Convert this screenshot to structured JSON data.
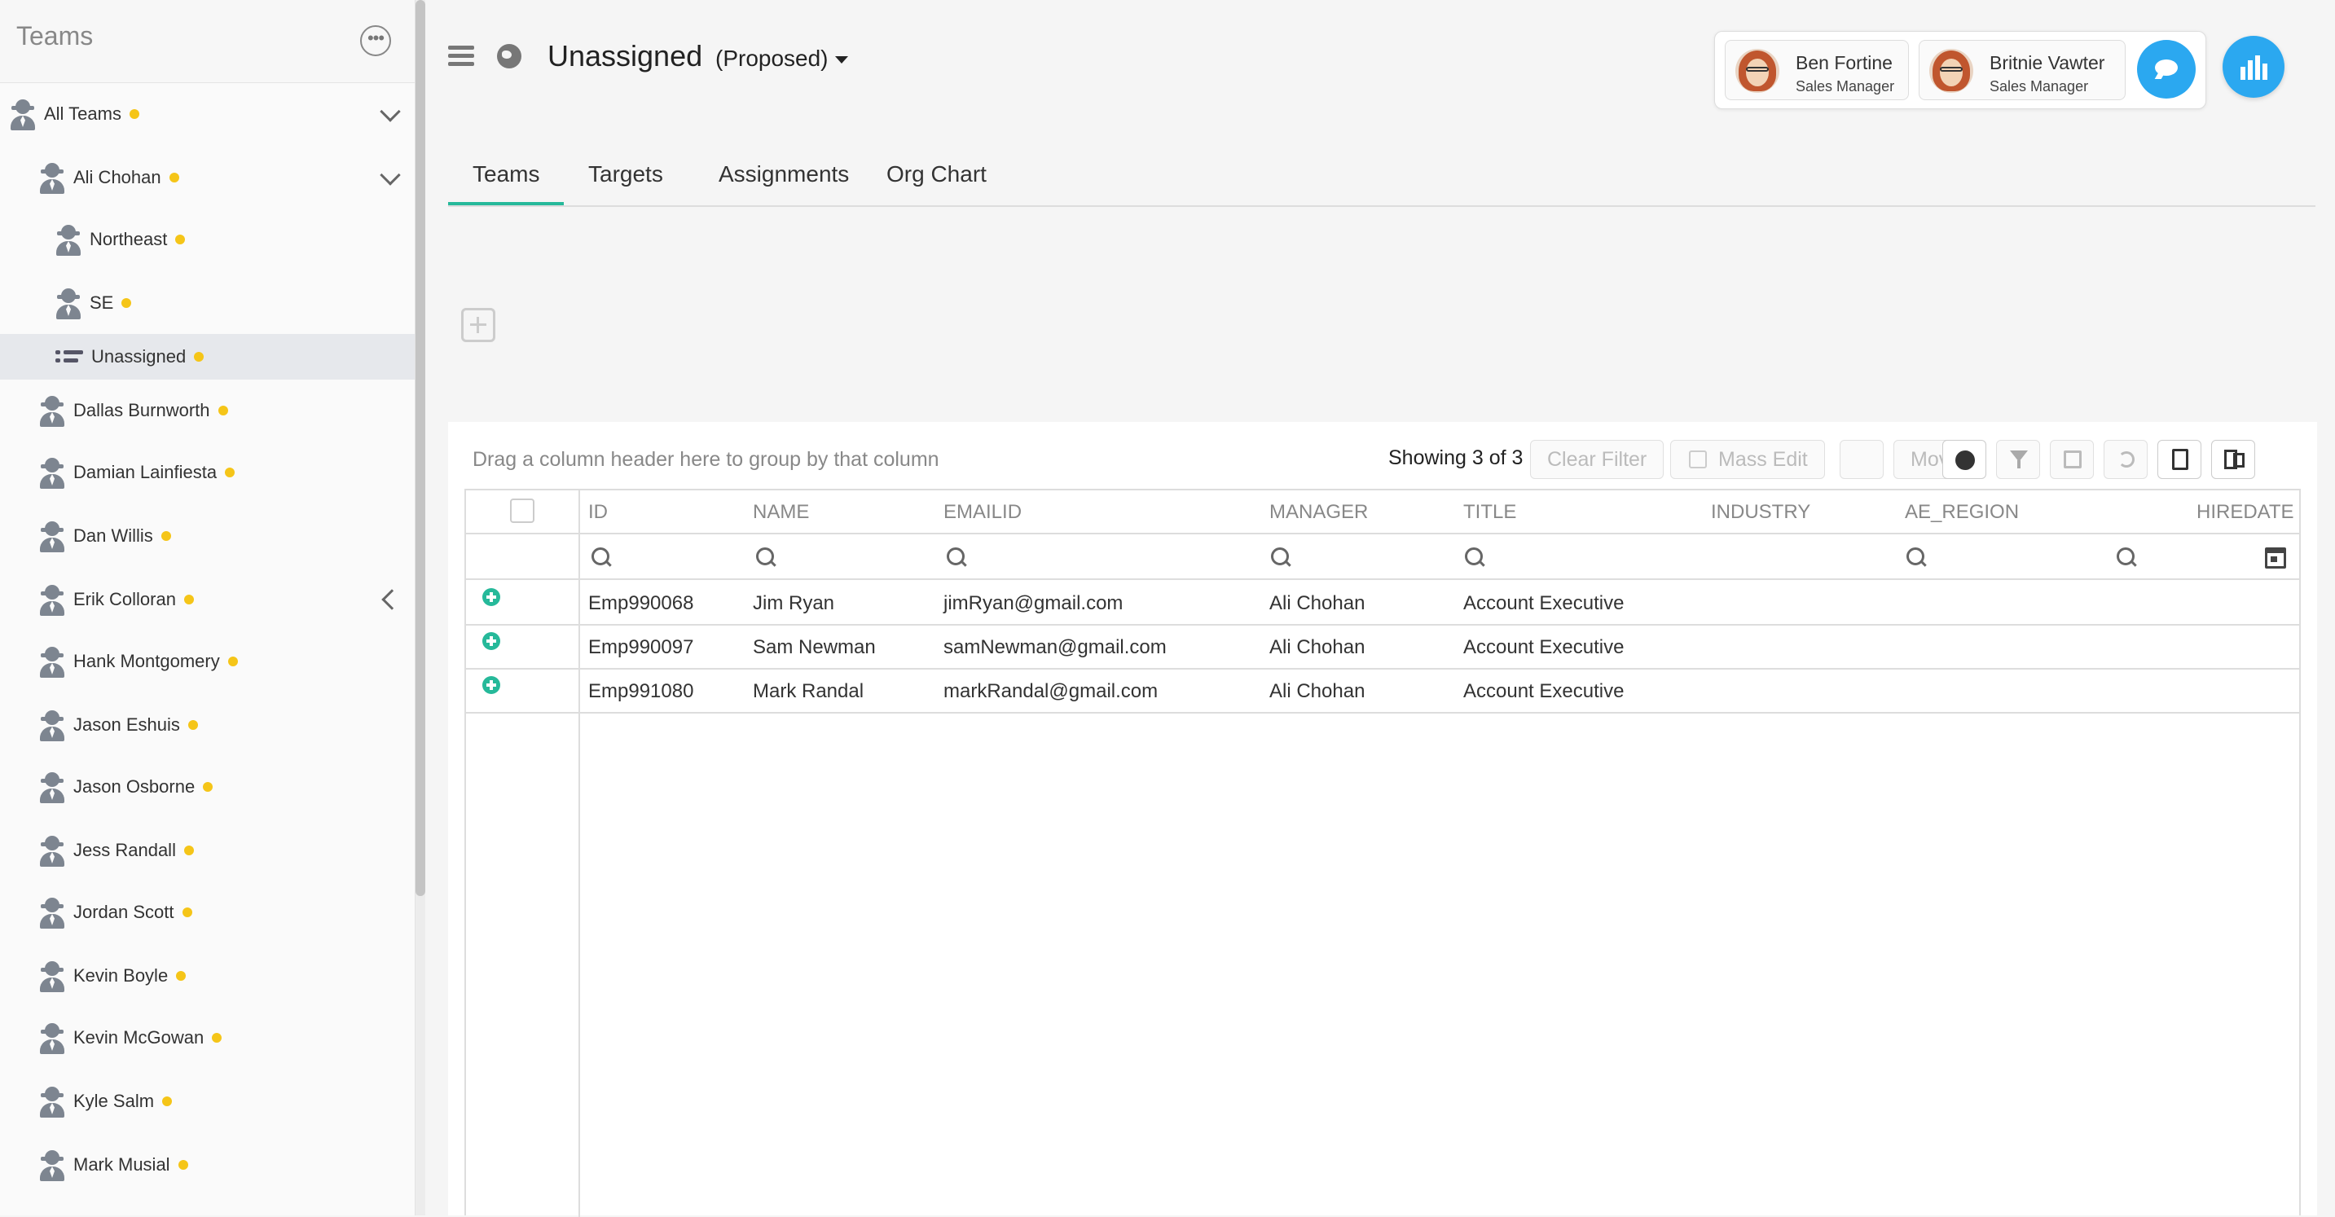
{
  "sidebar": {
    "title": "Teams",
    "items": [
      {
        "label": "All Teams",
        "level": 0,
        "expanded": true
      },
      {
        "label": "Ali Chohan",
        "level": 1,
        "expanded": true
      },
      {
        "label": "Northeast",
        "level": 2
      },
      {
        "label": "SE",
        "level": 2
      },
      {
        "label": "Unassigned",
        "level": 2,
        "selected": true
      },
      {
        "label": "Dallas Burnworth",
        "level": 1
      },
      {
        "label": "Damian Lainfiesta",
        "level": 1
      },
      {
        "label": "Dan Willis",
        "level": 1
      },
      {
        "label": "Erik Colloran",
        "level": 1,
        "collapsed_chevron": true
      },
      {
        "label": "Hank Montgomery",
        "level": 1
      },
      {
        "label": "Jason Eshuis",
        "level": 1
      },
      {
        "label": "Jason Osborne",
        "level": 1
      },
      {
        "label": "Jess Randall",
        "level": 1
      },
      {
        "label": "Jordan Scott",
        "level": 1
      },
      {
        "label": "Kevin Boyle",
        "level": 1
      },
      {
        "label": "Kevin McGowan",
        "level": 1
      },
      {
        "label": "Kyle Salm",
        "level": 1
      },
      {
        "label": "Mark Musial",
        "level": 1
      }
    ],
    "status_color": "#f5c518"
  },
  "header": {
    "title": "Unassigned",
    "scenario": "(Proposed)",
    "users": [
      {
        "name": "Ben Fortine",
        "role": "Sales Manager"
      },
      {
        "name": "Britnie Vawter",
        "role": "Sales Manager"
      }
    ],
    "accent": "#2ba8f0"
  },
  "tabs": [
    {
      "label": "Teams",
      "active": true
    },
    {
      "label": "Targets"
    },
    {
      "label": "Assignments"
    },
    {
      "label": "Org Chart"
    }
  ],
  "grid": {
    "group_hint": "Drag a column header here to group by that column",
    "showing": "Showing 3 of 3",
    "toolbar": {
      "clear_filter": "Clear Filter",
      "mass_edit": "Mass Edit",
      "move": "Move"
    },
    "columns": [
      "ID",
      "NAME",
      "EMAILID",
      "MANAGER",
      "TITLE",
      "INDUSTRY",
      "AE_REGION",
      "HIREDATE"
    ],
    "rows": [
      {
        "id": "Emp990068",
        "name": "Jim Ryan",
        "email": "jimRyan@gmail.com",
        "manager": "Ali Chohan",
        "title": "Account Executive"
      },
      {
        "id": "Emp990097",
        "name": "Sam Newman",
        "email": "samNewman@gmail.com",
        "manager": "Ali Chohan",
        "title": "Account Executive"
      },
      {
        "id": "Emp991080",
        "name": "Mark Randal",
        "email": "markRandal@gmail.com",
        "manager": "Ali Chohan",
        "title": "Account Executive"
      }
    ],
    "accent": "#26b99a"
  }
}
